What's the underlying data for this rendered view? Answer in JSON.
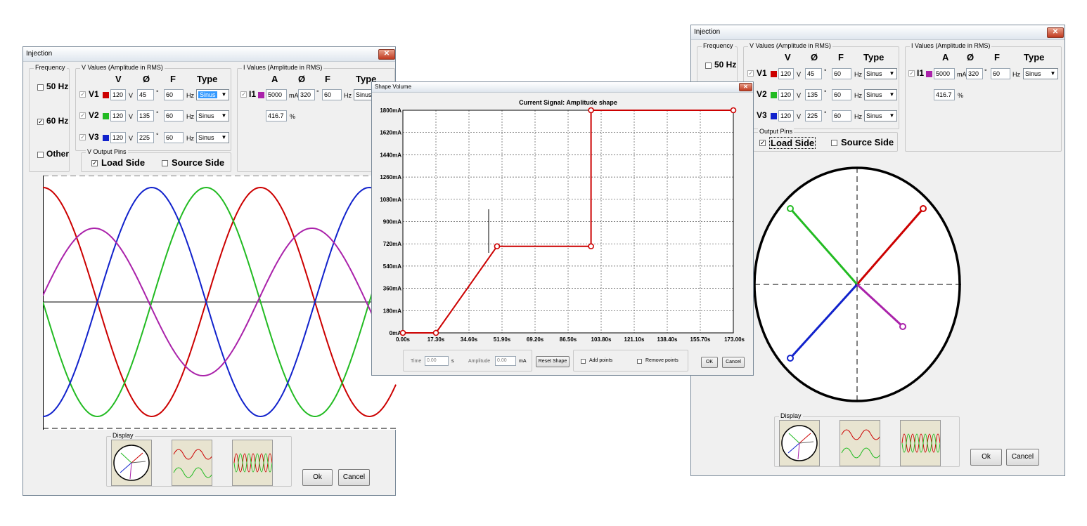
{
  "left_window": {
    "title": "Injection",
    "frequency": {
      "group_label": "Frequency",
      "opt_50": "50 Hz",
      "opt_60": "60 Hz",
      "opt_other": "Other",
      "checked_mark": "✓"
    },
    "v_values": {
      "group_label": "V Values (Amplitude in RMS)",
      "col_v": "V",
      "col_phase": "Ø",
      "col_f": "F",
      "col_type": "Type",
      "rows": [
        {
          "name": "V1",
          "amp": "120",
          "unit": "V",
          "phase": "45",
          "deg": "°",
          "freq": "60",
          "hz": "Hz",
          "type": "Sinus",
          "color": "#cc0000"
        },
        {
          "name": "V2",
          "amp": "120",
          "unit": "V",
          "phase": "135",
          "deg": "°",
          "freq": "60",
          "hz": "Hz",
          "type": "Sinus",
          "color": "#22bb22"
        },
        {
          "name": "V3",
          "amp": "120",
          "unit": "V",
          "phase": "225",
          "deg": "°",
          "freq": "60",
          "hz": "Hz",
          "type": "Sinus",
          "color": "#1122cc"
        }
      ]
    },
    "output_pins": {
      "group_label": "V Output Pins",
      "load": "Load Side",
      "source": "Source Side"
    },
    "i_values": {
      "group_label": "I Values (Amplitude in RMS)",
      "col_a": "A",
      "col_phase": "Ø",
      "col_f": "F",
      "col_type": "Type",
      "row": {
        "name": "I1",
        "amp": "5000",
        "unit": "mA",
        "phase": "320",
        "deg": "°",
        "freq": "60",
        "hz": "Hz",
        "type": "Sinus",
        "color": "#aa22aa"
      },
      "percent": "416.7",
      "percent_unit": "%"
    },
    "display_label": "Display",
    "ok": "Ok",
    "cancel": "Cancel"
  },
  "shape_window": {
    "title": "Shape Volume",
    "chart_title": "Current Signal: Amplitude shape",
    "time_label": "Time",
    "time_value": "0.00",
    "time_unit": "s",
    "amp_label": "Amplitude",
    "amp_value": "0.00",
    "amp_unit": "mA",
    "reset": "Reset Shape",
    "add_points": "Add points",
    "remove_points": "Remove points",
    "ok": "OK",
    "cancel": "Cancel"
  },
  "chart_data": {
    "type": "line",
    "title": "Current Signal: Amplitude shape",
    "x_ticks": [
      "0.00s",
      "17.30s",
      "34.60s",
      "51.90s",
      "69.20s",
      "86.50s",
      "103.80s",
      "121.10s",
      "138.40s",
      "155.70s",
      "173.00s"
    ],
    "y_ticks": [
      "0mA",
      "180mA",
      "360mA",
      "540mA",
      "720mA",
      "900mA",
      "1080mA",
      "1260mA",
      "1440mA",
      "1620mA",
      "1800mA"
    ],
    "xlim": [
      0,
      173
    ],
    "ylim": [
      0,
      1800
    ],
    "series": [
      {
        "color": "#cc0000",
        "x": [
          0,
          17.3,
          49.3,
          98.5,
          98.5,
          173
        ],
        "y": [
          0,
          0,
          700,
          700,
          1800,
          1800
        ]
      }
    ],
    "grid": true
  },
  "right_window": {
    "title": "Injection",
    "frequency": {
      "group_label": "Frequency",
      "opt_50": "50 Hz"
    },
    "v_values": {
      "group_label": "V Values (Amplitude in RMS)",
      "col_v": "V",
      "col_phase": "Ø",
      "col_f": "F",
      "col_type": "Type",
      "rows": [
        {
          "name": "V1",
          "amp": "120",
          "unit": "V",
          "phase": "45",
          "deg": "°",
          "freq": "60",
          "hz": "Hz",
          "type": "Sinus",
          "color": "#cc0000"
        },
        {
          "name": "V2",
          "amp": "120",
          "unit": "V",
          "phase": "135",
          "deg": "°",
          "freq": "60",
          "hz": "Hz",
          "type": "Sinus",
          "color": "#22bb22"
        },
        {
          "name": "V3",
          "amp": "120",
          "unit": "V",
          "phase": "225",
          "deg": "°",
          "freq": "60",
          "hz": "Hz",
          "type": "Sinus",
          "color": "#1122cc"
        }
      ]
    },
    "output_pins": {
      "group_label": "Output Pins",
      "load": "Load Side",
      "source": "Source Side",
      "checked_mark": "✓"
    },
    "i_values": {
      "group_label": "I Values (Amplitude in RMS)",
      "col_a": "A",
      "col_phase": "Ø",
      "col_f": "F",
      "col_type": "Type",
      "row": {
        "name": "I1",
        "amp": "5000",
        "unit": "mA",
        "phase": "320",
        "deg": "°",
        "freq": "60",
        "hz": "Hz",
        "type": "Sinus",
        "color": "#aa22aa"
      },
      "percent": "416.7",
      "percent_unit": "%"
    },
    "display_label": "Display",
    "ok": "Ok",
    "cancel": "Cancel"
  }
}
